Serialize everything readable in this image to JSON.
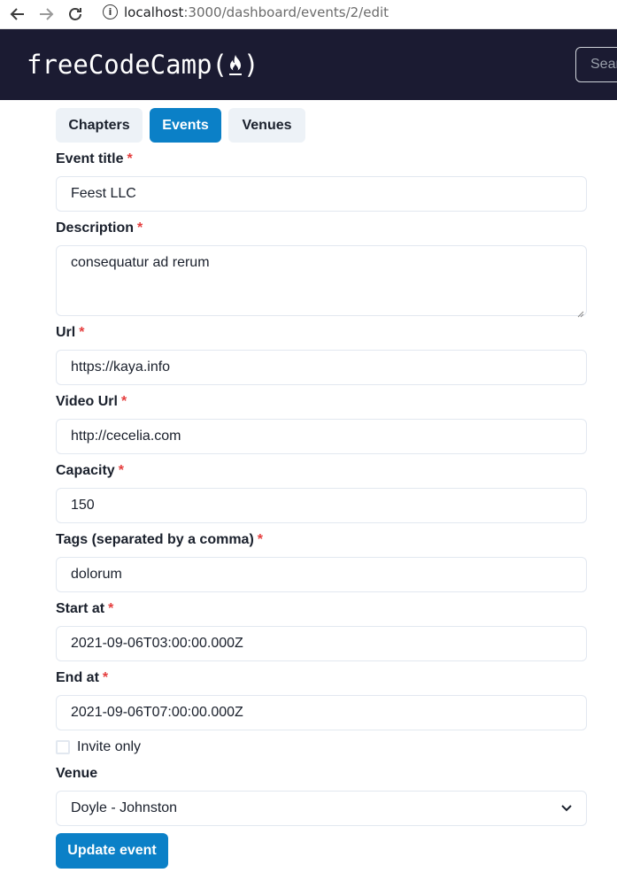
{
  "browser": {
    "url_host": "localhost",
    "url_path": ":3000/dashboard/events/2/edit"
  },
  "header": {
    "logo_text": "freeCodeCamp(",
    "logo_close": ")",
    "search_placeholder": "Sear"
  },
  "tabs": [
    {
      "label": "Chapters"
    },
    {
      "label": "Events"
    },
    {
      "label": "Venues"
    }
  ],
  "form": {
    "required_mark": "*",
    "event_title": {
      "label": "Event title",
      "value": "Feest LLC"
    },
    "description": {
      "label": "Description",
      "value": "consequatur ad rerum"
    },
    "url": {
      "label": "Url",
      "value": "https://kaya.info"
    },
    "video_url": {
      "label": "Video Url",
      "value": "http://cecelia.com"
    },
    "capacity": {
      "label": "Capacity",
      "value": "150"
    },
    "tags": {
      "label": "Tags (separated by a comma)",
      "value": "dolorum"
    },
    "start_at": {
      "label": "Start at",
      "value": "2021-09-06T03:00:00.000Z"
    },
    "end_at": {
      "label": "End at",
      "value": "2021-09-06T07:00:00.000Z"
    },
    "invite_only": {
      "label": "Invite only",
      "checked": false
    },
    "venue": {
      "label": "Venue",
      "selected": "Doyle - Johnston"
    },
    "submit_label": "Update event"
  },
  "colors": {
    "header_bg": "#1b1b32",
    "primary": "#0b80c7",
    "tab_bg": "#edf2f7",
    "required": "#e53e3e"
  }
}
